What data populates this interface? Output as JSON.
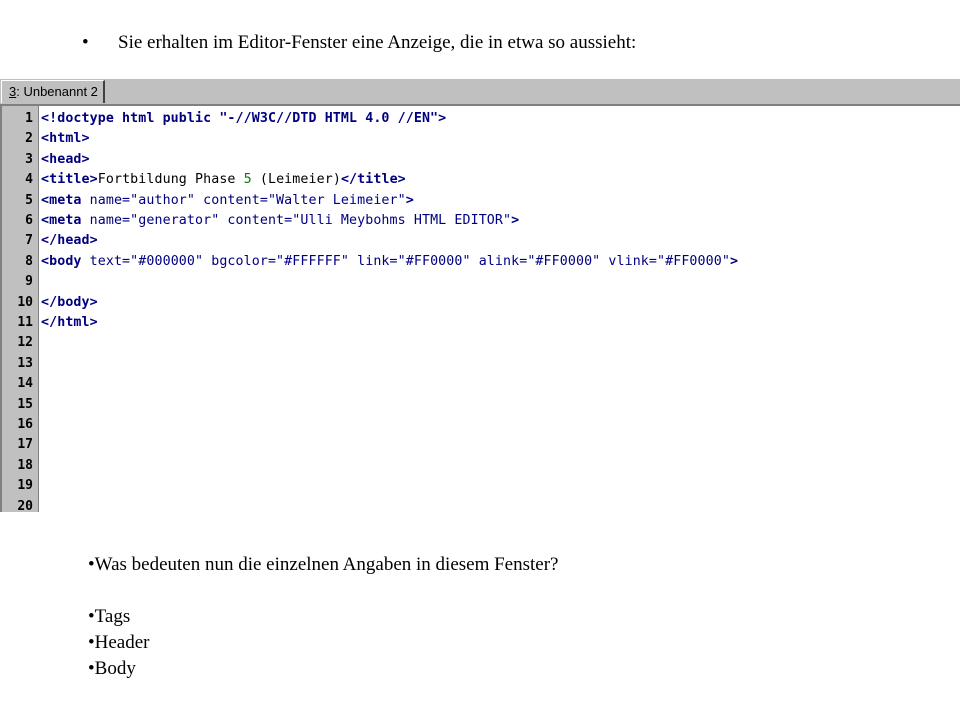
{
  "intro": {
    "bullet": "•",
    "text": "Sie erhalten im Editor-Fenster eine Anzeige, die in etwa so aussieht:"
  },
  "editor": {
    "tab": {
      "hotkey": "3",
      "rest": ": Unbenannt 2"
    },
    "line_numbers": [
      "1",
      "2",
      "3",
      "4",
      "5",
      "6",
      "7",
      "8",
      "9",
      "10",
      "11",
      "12",
      "13",
      "14",
      "15",
      "16",
      "17",
      "18",
      "19",
      "20"
    ],
    "lines": [
      [
        {
          "t": "<!doctype html public \"-//W3C//DTD HTML 4.0 //EN\">",
          "k": "tag"
        }
      ],
      [
        {
          "t": "<html>",
          "k": "tag"
        }
      ],
      [
        {
          "t": "<head>",
          "k": "tag"
        }
      ],
      [
        {
          "t": "<title>",
          "k": "tag"
        },
        {
          "t": "Fortbildung Phase ",
          "k": "txt"
        },
        {
          "t": "5",
          "k": "numc"
        },
        {
          "t": " (Leimeier)",
          "k": "txt"
        },
        {
          "t": "</title>",
          "k": "tag"
        }
      ],
      [
        {
          "t": "<meta",
          "k": "tag"
        },
        {
          "t": " name=\"author\" content=\"Walter Leimeier\"",
          "k": "attr"
        },
        {
          "t": ">",
          "k": "tag"
        }
      ],
      [
        {
          "t": "<meta",
          "k": "tag"
        },
        {
          "t": " name=\"generator\" content=\"Ulli Meybohms HTML EDITOR\"",
          "k": "attr"
        },
        {
          "t": ">",
          "k": "tag"
        }
      ],
      [
        {
          "t": "</head>",
          "k": "tag"
        }
      ],
      [
        {
          "t": "<body",
          "k": "tag"
        },
        {
          "t": " text=\"#000000\" bgcolor=\"#FFFFFF\" link=\"#FF0000\" alink=\"#FF0000\" vlink=\"#FF0000\"",
          "k": "attr"
        },
        {
          "t": ">",
          "k": "tag"
        }
      ],
      [],
      [
        {
          "t": "</body>",
          "k": "tag"
        }
      ],
      [
        {
          "t": "</html>",
          "k": "tag"
        }
      ],
      [],
      [],
      [],
      [],
      [],
      [],
      [],
      [],
      []
    ]
  },
  "questions": {
    "items": [
      "•Was bedeuten nun die einzelnen Angaben in diesem Fenster?",
      "",
      "•Tags",
      "•Header",
      "•Body"
    ]
  }
}
